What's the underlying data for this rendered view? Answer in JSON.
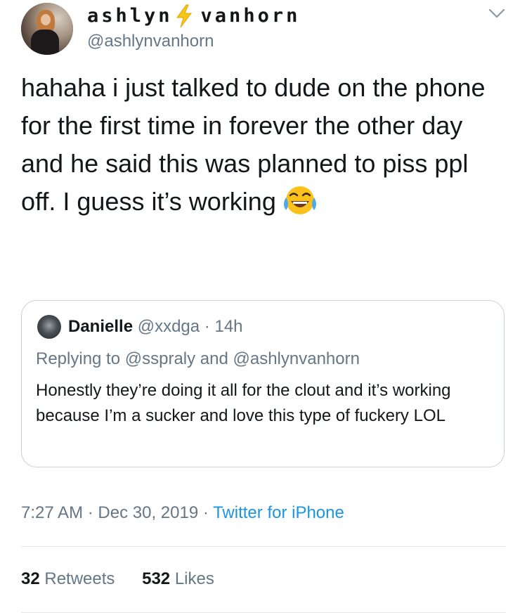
{
  "author": {
    "display_name_part1": "ashlyn",
    "display_name_part2": "vanhorn",
    "name_emoji": "high-voltage-icon",
    "handle": "@ashlynvanhorn",
    "menu_icon": "chevron-down-icon"
  },
  "tweet": {
    "text": "hahaha i just talked to dude on the phone for the first time in forever the other day and he said this was planned to piss ppl off. I guess it’s working",
    "emoji": "face-with-tears-of-joy-icon"
  },
  "quoted_tweet": {
    "name": "Danielle",
    "handle": "@xxdga",
    "separator": "·",
    "time": "14h",
    "replying_to": "Replying to @sspraly and @ashlynvanhorn",
    "text": "Honestly they’re doing it all for the clout and it’s working because I’m a sucker and love this type of fuckery LOL"
  },
  "meta": {
    "time": "7:27 AM",
    "separator": "·",
    "date": "Dec 30, 2019",
    "source": "Twitter for iPhone"
  },
  "stats": {
    "retweets_count": "32",
    "retweets_label": "Retweets",
    "likes_count": "532",
    "likes_label": "Likes"
  },
  "colors": {
    "text": "#14171a",
    "secondary": "#657786",
    "link": "#1b95e0",
    "border": "#c9d2d9",
    "divider": "#e1e8ed",
    "bolt": "#f5c51a"
  }
}
